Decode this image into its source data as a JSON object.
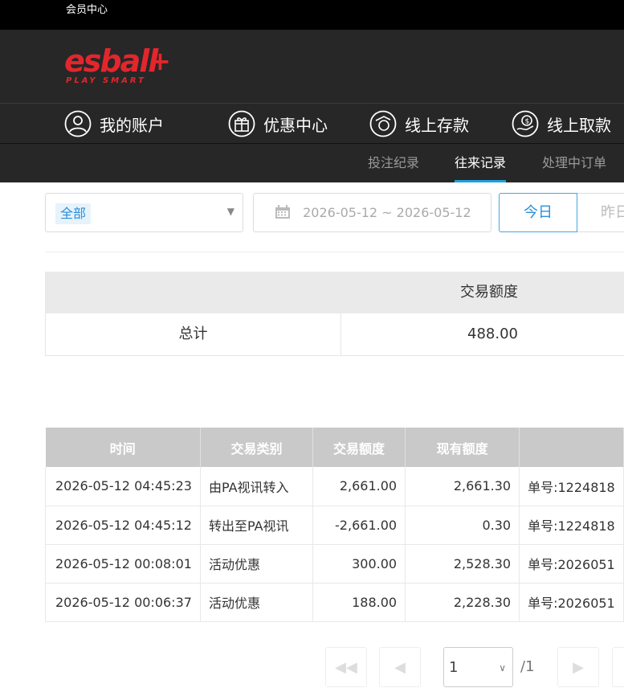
{
  "topbar": {
    "title": "会员中心"
  },
  "logo": {
    "brand": "esball+",
    "tagline": "PLAY SMART",
    "color": "#e3262d"
  },
  "nav": [
    {
      "label": "我的账户",
      "icon": "user-icon"
    },
    {
      "label": "优惠中心",
      "icon": "gift-icon"
    },
    {
      "label": "线上存款",
      "icon": "deposit-icon"
    },
    {
      "label": "线上取款",
      "icon": "withdraw-icon"
    }
  ],
  "subnav": [
    {
      "label": "投注纪录",
      "active": false
    },
    {
      "label": "往来记录",
      "active": true
    },
    {
      "label": "处理中订单",
      "active": false
    }
  ],
  "filters": {
    "type_selected": "全部",
    "date_range": "2026-05-12 ~ 2026-05-12",
    "today_label": "今日",
    "yesterday_label": "昨日"
  },
  "summary": {
    "header": "交易额度",
    "row_label": "总计",
    "row_value": "488.00"
  },
  "table": {
    "headers": [
      "时间",
      "交易类别",
      "交易额度",
      "现有额度",
      ""
    ],
    "rows": [
      [
        "2026-05-12 04:45:23",
        "由PA视讯转入",
        "2,661.00",
        "2,661.30",
        "单号:1224818"
      ],
      [
        "2026-05-12 04:45:12",
        "转出至PA视讯",
        "-2,661.00",
        "0.30",
        "单号:1224818"
      ],
      [
        "2026-05-12 00:08:01",
        "活动优惠",
        "300.00",
        "2,528.30",
        "单号:2026051"
      ],
      [
        "2026-05-12 00:06:37",
        "活动优惠",
        "188.00",
        "2,228.30",
        "单号:2026051"
      ]
    ]
  },
  "pager": {
    "current": "1",
    "total": "/1"
  },
  "colors": {
    "accent": "#1da2e0",
    "header_bg": "#272727",
    "th_bg": "#c9c9c9"
  }
}
